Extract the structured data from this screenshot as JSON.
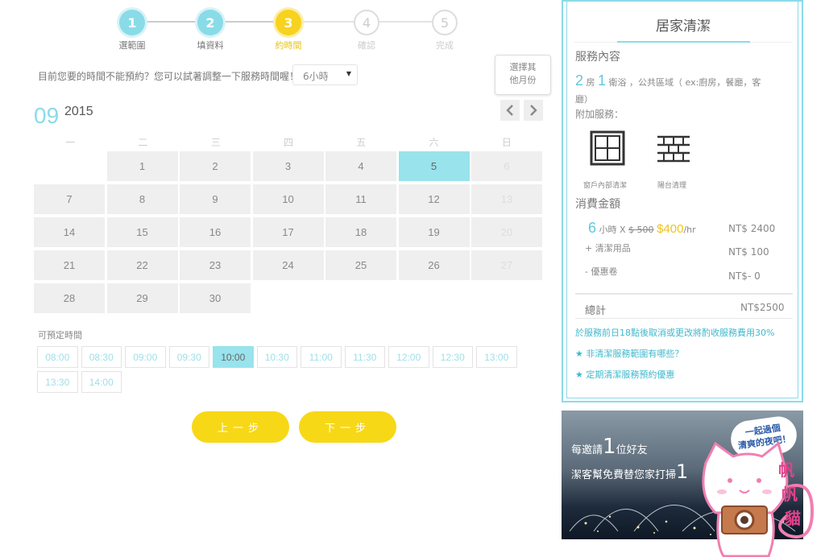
{
  "stepper": {
    "steps": [
      {
        "num": "1",
        "label": "選範圍"
      },
      {
        "num": "2",
        "label": "填資料"
      },
      {
        "num": "3",
        "label": "約時間"
      },
      {
        "num": "4",
        "label": "確認"
      },
      {
        "num": "5",
        "label": "完成"
      }
    ]
  },
  "hint": "目前您要的時間不能預約？您可以試著調整一下服務時間喔！",
  "hour_select": "6小時",
  "tooltip": {
    "line1": "選擇其",
    "line2": "他月份"
  },
  "calendar": {
    "month": "09",
    "year": "2015",
    "weekdays": [
      "一",
      "二",
      "三",
      "四",
      "五",
      "六",
      "日"
    ],
    "rows": [
      [
        "",
        "1",
        "2",
        "3",
        "4",
        "5",
        "6"
      ],
      [
        "7",
        "8",
        "9",
        "10",
        "11",
        "12",
        "13"
      ],
      [
        "14",
        "15",
        "16",
        "17",
        "18",
        "19",
        "20"
      ],
      [
        "21",
        "22",
        "23",
        "24",
        "25",
        "26",
        "27"
      ],
      [
        "28",
        "29",
        "30",
        "",
        "",
        "",
        ""
      ]
    ],
    "selected": "5"
  },
  "slots": {
    "label": "可預定時間",
    "times": [
      "08:00",
      "08:30",
      "09:00",
      "09:30",
      "10:00",
      "10:30",
      "11:00",
      "11:30",
      "12:00",
      "12:30",
      "13:00",
      "13:30",
      "14:00"
    ],
    "selected": "10:00"
  },
  "buttons": {
    "prev": "上一步",
    "next": "下一步"
  },
  "panel": {
    "title": "居家清潔",
    "service_heading": "服務內容",
    "rooms": "2",
    "rooms_unit": "房",
    "baths": "1",
    "baths_unit": "衛浴",
    "public_areas_1": "，公共區域（ ex:廚房，餐廳，客",
    "public_areas_2": "廳）",
    "addon_heading": "附加服務：",
    "addons": [
      {
        "icon": "window-icon",
        "label": "窗戶內部清潔"
      },
      {
        "icon": "balcony-icon",
        "label": "陽台清理"
      }
    ],
    "cost_heading": "消費金額",
    "hours": "6",
    "hours_unit": "小時 X",
    "old_price": "$ 500",
    "new_price": "$400",
    "per_hour": "/hr",
    "hours_total": "NT$ 2400",
    "supplies_label": "+ 清潔用品",
    "supplies_price": "NT$ 100",
    "coupon_label": "- 優惠卷",
    "coupon_price": "NT$- 0",
    "total_label": "總計",
    "total_price": "NT$2500",
    "cancel_note": "於服務前日18點後取消或更改將酌收服務費用30%",
    "link1": "★ 非清潔服務範圍有哪些？",
    "link2": "★ 定期清潔服務預約優惠"
  },
  "ad": {
    "line1_a": "每邀請",
    "line1_num": "1",
    "line1_b": "位好友",
    "line2_a": "潔客幫免費替您家打掃",
    "line2_num": "1",
    "bubble_1": "一起過個",
    "bubble_2": "清爽的夜吧！"
  },
  "colors": {
    "accent": "#8adbe8",
    "yellow": "#f7d817"
  }
}
